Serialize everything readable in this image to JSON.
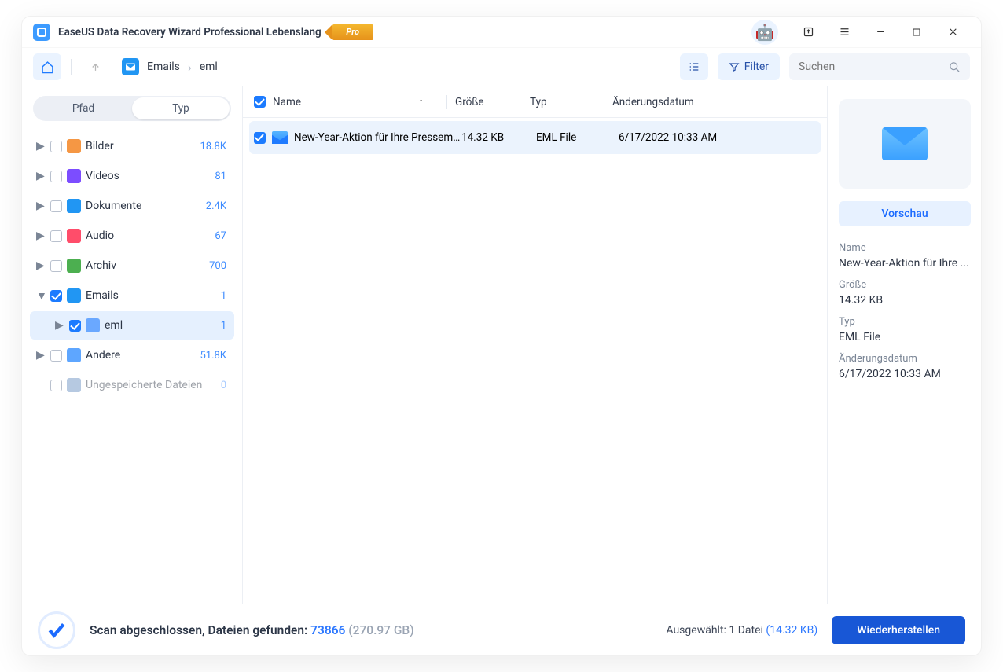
{
  "title": "EaseUS Data Recovery Wizard Professional Lebenslang",
  "pro_badge": "Pro",
  "toolbar": {
    "filter_label": "Filter",
    "search_placeholder": "Suchen"
  },
  "breadcrumb": {
    "root": "Emails",
    "current": "eml"
  },
  "tabs": {
    "path": "Pfad",
    "type": "Typ"
  },
  "categories": [
    {
      "icon": "#f59744",
      "label": "Bilder",
      "count": "18.8K",
      "checked": false,
      "expanded": false
    },
    {
      "icon": "#7c4dff",
      "label": "Videos",
      "count": "81",
      "checked": false,
      "expanded": false
    },
    {
      "icon": "#2196f3",
      "label": "Dokumente",
      "count": "2.4K",
      "checked": false,
      "expanded": false
    },
    {
      "icon": "#ff4d6a",
      "label": "Audio",
      "count": "67",
      "checked": false,
      "expanded": false
    },
    {
      "icon": "#4caf50",
      "label": "Archiv",
      "count": "700",
      "checked": false,
      "expanded": false
    },
    {
      "icon": "#2196f3",
      "label": "Emails",
      "count": "1",
      "checked": true,
      "expanded": true,
      "children": [
        {
          "icon": "#6aa8ff",
          "label": "eml",
          "count": "1",
          "checked": true,
          "selected": true
        }
      ]
    },
    {
      "icon": "#5ea6ff",
      "label": "Andere",
      "count": "51.8K",
      "checked": false,
      "expanded": false
    },
    {
      "icon": "#b6c9e1",
      "label": "Ungespeicherte Dateien",
      "count": "0",
      "checked": false,
      "dim": true,
      "noexpand": true
    }
  ],
  "columns": {
    "name": "Name",
    "size": "Größe",
    "type": "Typ",
    "date": "Änderungsdatum"
  },
  "rows": [
    {
      "name": "New-Year-Aktion für Ihre Pressemit...",
      "size": "14.32 KB",
      "type": "EML File",
      "date": "6/17/2022 10:33 AM",
      "checked": true,
      "selected": true
    }
  ],
  "preview": {
    "btn": "Vorschau",
    "name_label": "Name",
    "name": "New-Year-Aktion für Ihre ...",
    "size_label": "Größe",
    "size": "14.32 KB",
    "type_label": "Typ",
    "type": "EML File",
    "date_label": "Änderungsdatum",
    "date": "6/17/2022 10:33 AM"
  },
  "status": {
    "scan_prefix": "Scan abgeschlossen, Dateien gefunden: ",
    "count": "73866",
    "total_size": " (270.97 GB)",
    "selected_prefix": "Ausgewählt: 1 Datei ",
    "selected_size": "(14.32 KB)",
    "recover": "Wiederherstellen"
  }
}
